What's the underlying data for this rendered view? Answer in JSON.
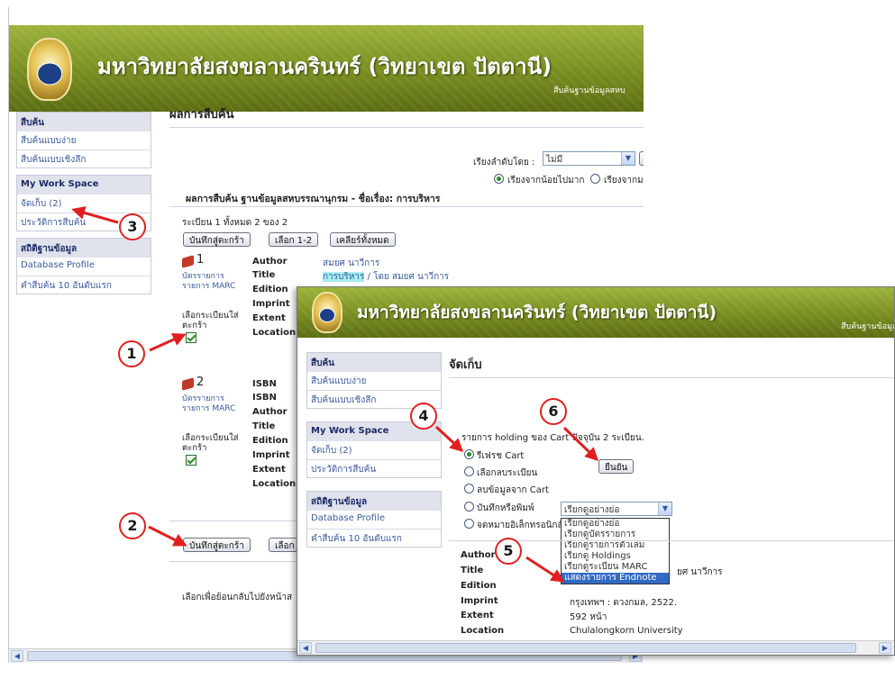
{
  "banner": {
    "title": "มหาวิทยาลัยสงขลานครินทร์ (วิทยาเขต ปัตตานี)",
    "subtitle": "สืบค้นฐานข้อมูลสหบ"
  },
  "sidebar": {
    "search_head": "สืบค้น",
    "search_items": [
      "สืบค้นแบบง่าย",
      "สืบค้นแบบเชิงลึก"
    ],
    "workspace_head": "My Work Space",
    "workspace_items": [
      "จัดเก็บ (2)",
      "ประวัติการสืบค้น"
    ],
    "stats_head": "สถิติฐานข้อมูล",
    "stats_items": [
      "Database Profile",
      "คำสืบค้น 10 อันดับแรก"
    ]
  },
  "results": {
    "page_title": "ผลการสืบค้น",
    "sort_label": "เรียงลำดับโดย :",
    "sort_value": "ไม่มี",
    "sort_asc": "เรียงจากน้อยไปมาก",
    "sort_desc": "เรียงจากม",
    "header": "ผลการสืบค้น ฐานข้อมูลสหบรรณานุกรม - ชื่อเรื่อง: การบริหาร",
    "count_line": "ระเบียน 1 ทั้งหมด 2 ของ 2",
    "btn_save_cart": "บันทึกสู่ตะกร้า",
    "btn_select": "เลือก 1-2",
    "btn_clear": "เคลียร์ทั้งหมด",
    "btn_select_short": "เลือก",
    "record_links": [
      "บัตรรายการ",
      "รายการ MARC"
    ],
    "select_cart_label_1": "เลือกระเบียนใส่",
    "select_cart_label_2": "ตะกร้า",
    "record1": {
      "num": "1",
      "fields": [
        "Author",
        "Title",
        "Edition",
        "Imprint",
        "Extent",
        "Location"
      ],
      "author": "สมยศ นาวีการ",
      "title_hl": "การบริหาร",
      "title_rest": " / โดย สมยศ นาวีการ"
    },
    "record2": {
      "num": "2",
      "fields": [
        "ISBN",
        "ISBN",
        "Author",
        "Title",
        "Edition",
        "Imprint",
        "Extent",
        "Location"
      ]
    },
    "footer": "เลือกเพื่อย้อนกลับไปยังหน้าส"
  },
  "cart": {
    "page_title": "จัดเก็บ",
    "holding_text": "รายการ holding ของ Cart ปัจจุบัน 2 ระเบียน.",
    "options": [
      "รีเฟรช Cart",
      "เลือกลบระเบียน",
      "ลบข้อมูลจาก Cart",
      "บันทึกหรือพิมพ์",
      "จดหมายอิเล็กทรอนิกส์"
    ],
    "confirm_btn": "ยืนยัน",
    "format_select": "เรียกดูอย่างย่อ",
    "format_options": [
      "เรียกดูอย่างย่อ",
      "เรียกดูบัตรรายการ",
      "เรียกดูรายการตัวเล่ม",
      "เรียกดู Holdings",
      "เรียกดูระเบียน MARC",
      "แสดงรายการ Endnote"
    ],
    "fields": [
      "Author",
      "Title",
      "Edition",
      "Imprint",
      "Extent",
      "Location"
    ],
    "title_rest": "ยศ นาวีการ",
    "imprint": "กรุงเทพฯ : ดวงกมล, 2522.",
    "extent": "592 หน้า",
    "location": "Chulalongkorn University"
  },
  "callouts": [
    "1",
    "2",
    "3",
    "4",
    "5",
    "6"
  ],
  "colors": {
    "callout": "#e02020",
    "banner": "#7e9424",
    "link": "#3a5a9a",
    "highlight": "#a8eef2"
  }
}
